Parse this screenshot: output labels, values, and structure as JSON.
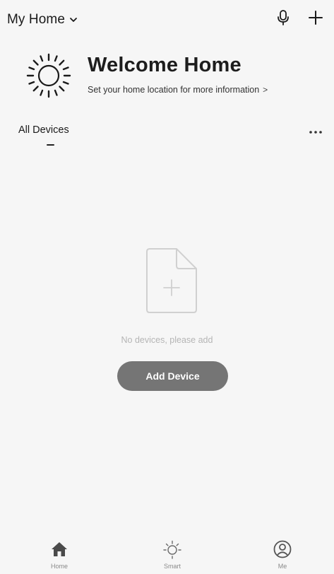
{
  "header": {
    "home_name": "My Home",
    "icons": {
      "chevron": "chevron-down-icon",
      "mic": "microphone-icon",
      "add": "plus-icon"
    }
  },
  "welcome": {
    "title": "Welcome Home",
    "location_prompt": "Set your home location for more information",
    "location_arrow": ">",
    "icon": "sun-icon"
  },
  "devices": {
    "tab_label": "All Devices",
    "more_icon": "more-dots-icon"
  },
  "empty_state": {
    "icon": "add-document-icon",
    "message": "No devices, please add",
    "button_label": "Add Device"
  },
  "bottom_nav": {
    "items": [
      {
        "label": "Home",
        "icon": "home-icon",
        "active": true
      },
      {
        "label": "Smart",
        "icon": "smart-sun-icon",
        "active": false
      },
      {
        "label": "Me",
        "icon": "profile-icon",
        "active": false
      }
    ]
  },
  "colors": {
    "background": "#f6f6f6",
    "button": "#757575",
    "muted_text": "#b5b5b5",
    "primary_text": "#1a1a1a"
  }
}
